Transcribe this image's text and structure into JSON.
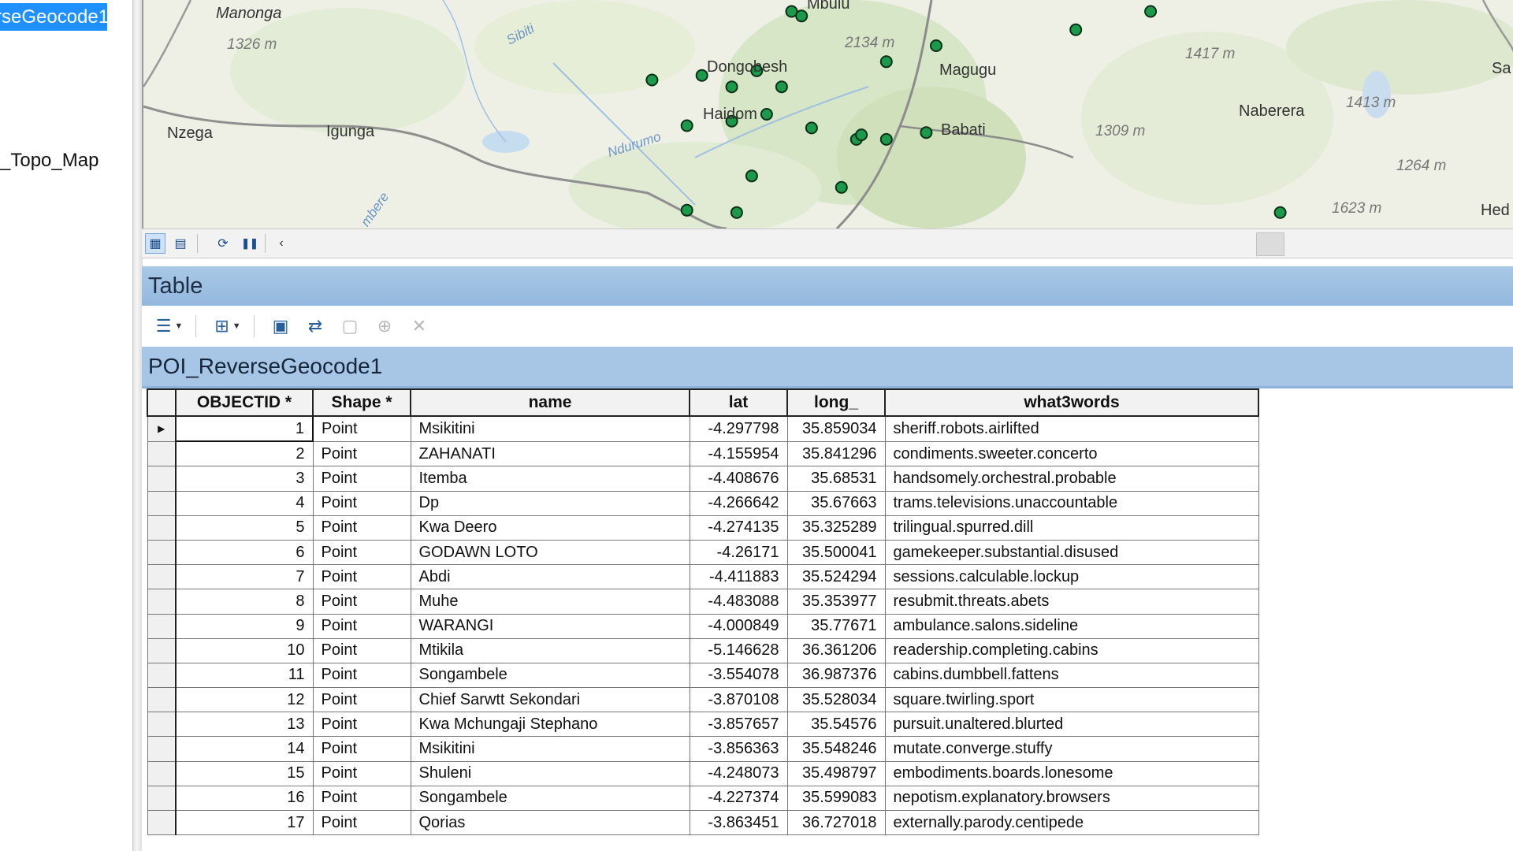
{
  "toc": {
    "selected_layer": "rseGeocode1",
    "basemap_layer": "_Topo_Map"
  },
  "map": {
    "place_labels": [
      "Manonga",
      "Mbulu",
      "Dongobesh",
      "Magugu",
      "Haidom",
      "Babati",
      "Nzega",
      "Igunga",
      "Naberera",
      "Sa",
      "Hed"
    ],
    "elevation_labels": [
      "1326 m",
      "2134 m",
      "1417 m",
      "1413 m",
      "1309 m",
      "1264 m",
      "1623 m"
    ],
    "river_labels": [
      "Sibiti",
      "Ndurumo",
      "mbere"
    ],
    "point_color": "#1a9a4a",
    "poi_points": [
      {
        "lat": -3.6,
        "lon": 35.55
      },
      {
        "lat": -3.62,
        "lon": 35.57
      },
      {
        "lat": -3.9,
        "lon": 35.27
      },
      {
        "lat": -3.88,
        "lon": 35.37
      },
      {
        "lat": -3.93,
        "lon": 35.43
      },
      {
        "lat": -3.93,
        "lon": 35.53
      },
      {
        "lat": -3.82,
        "lon": 35.74
      },
      {
        "lat": -3.86,
        "lon": 35.48
      },
      {
        "lat": -4.1,
        "lon": 35.34
      },
      {
        "lat": -4.08,
        "lon": 35.43
      },
      {
        "lat": -4.05,
        "lon": 35.5
      },
      {
        "lat": -4.11,
        "lon": 35.59
      },
      {
        "lat": -4.16,
        "lon": 35.68
      },
      {
        "lat": -4.14,
        "lon": 35.69
      },
      {
        "lat": -4.13,
        "lon": 35.82
      },
      {
        "lat": -4.16,
        "lon": 35.74
      },
      {
        "lat": -3.75,
        "lon": 35.84
      },
      {
        "lat": -4.32,
        "lon": 35.47
      },
      {
        "lat": -4.37,
        "lon": 35.65
      },
      {
        "lat": -4.47,
        "lon": 35.34
      },
      {
        "lat": -4.48,
        "lon": 35.44
      },
      {
        "lat": -3.6,
        "lon": 36.27
      },
      {
        "lat": -3.68,
        "lon": 36.12
      },
      {
        "lat": -4.48,
        "lon": 36.53
      }
    ]
  },
  "map_status_bar": {
    "buttons": [
      "layout-view-icon",
      "data-view-icon",
      "refresh-icon",
      "pause-icon",
      "scroll-left-icon"
    ]
  },
  "table_window": {
    "title": "Table",
    "layer_tab": "POI_ReverseGeocode1",
    "columns": [
      "OBJECTID *",
      "Shape *",
      "name",
      "lat",
      "long_",
      "what3words"
    ],
    "rows": [
      [
        "1",
        "Point",
        "Msikitini",
        "-4.297798",
        "35.859034",
        "sheriff.robots.airlifted"
      ],
      [
        "2",
        "Point",
        "ZAHANATI",
        "-4.155954",
        "35.841296",
        "condiments.sweeter.concerto"
      ],
      [
        "3",
        "Point",
        "Itemba",
        "-4.408676",
        "35.68531",
        "handsomely.orchestral.probable"
      ],
      [
        "4",
        "Point",
        "Dp",
        "-4.266642",
        "35.67663",
        "trams.televisions.unaccountable"
      ],
      [
        "5",
        "Point",
        "Kwa Deero",
        "-4.274135",
        "35.325289",
        "trilingual.spurred.dill"
      ],
      [
        "6",
        "Point",
        "GODAWN LOTO",
        "-4.26171",
        "35.500041",
        "gamekeeper.substantial.disused"
      ],
      [
        "7",
        "Point",
        "Abdi",
        "-4.411883",
        "35.524294",
        "sessions.calculable.lockup"
      ],
      [
        "8",
        "Point",
        "Muhe",
        "-4.483088",
        "35.353977",
        "resubmit.threats.abets"
      ],
      [
        "9",
        "Point",
        "WARANGI",
        "-4.000849",
        "35.77671",
        "ambulance.salons.sideline"
      ],
      [
        "10",
        "Point",
        "Mtikila",
        "-5.146628",
        "36.361206",
        "readership.completing.cabins"
      ],
      [
        "11",
        "Point",
        "Songambele",
        "-3.554078",
        "36.987376",
        "cabins.dumbbell.fattens"
      ],
      [
        "12",
        "Point",
        "Chief Sarwtt Sekondari",
        "-3.870108",
        "35.528034",
        "square.twirling.sport"
      ],
      [
        "13",
        "Point",
        "Kwa Mchungaji Stephano",
        "-3.857657",
        "35.54576",
        "pursuit.unaltered.blurted"
      ],
      [
        "14",
        "Point",
        "Msikitini",
        "-3.856363",
        "35.548246",
        "mutate.converge.stuffy"
      ],
      [
        "15",
        "Point",
        "Shuleni",
        "-4.248073",
        "35.498797",
        "embodiments.boards.lonesome"
      ],
      [
        "16",
        "Point",
        "Songambele",
        "-4.227374",
        "35.599083",
        "nepotism.explanatory.browsers"
      ],
      [
        "17",
        "Point",
        "Qorias",
        "-3.863451",
        "36.727018",
        "externally.parody.centipede"
      ]
    ]
  }
}
